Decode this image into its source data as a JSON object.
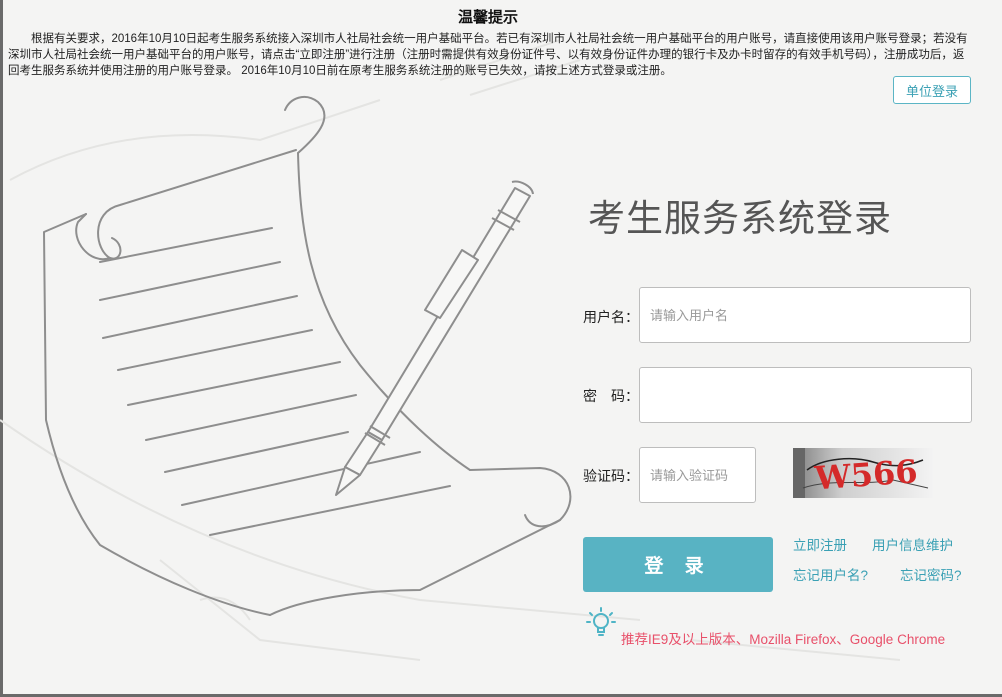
{
  "notice": {
    "title": "温馨提示",
    "body": "根据有关要求，2016年10月10日起考生服务系统接入深圳市人社局社会统一用户基础平台。若已有深圳市人社局社会统一用户基础平台的用户账号，请直接使用该用户账号登录；若没有深圳市人社局社会统一用户基础平台的用户账号，请点击“立即注册”进行注册（注册时需提供有效身份证件号、以有效身份证件办理的银行卡及办卡时留存的有效手机号码），注册成功后，返回考生服务系统并使用注册的用户账号登录。 2016年10月10日前在原考生服务系统注册的账号已失效，请按上述方式登录或注册。"
  },
  "unit_login_label": "单位登录",
  "login": {
    "title": "考生服务系统登录",
    "username": {
      "label": "用户名：",
      "placeholder": "请输入用户名",
      "value": ""
    },
    "password": {
      "label": "密　码：",
      "placeholder": "",
      "value": ""
    },
    "captcha": {
      "label": "验证码：",
      "placeholder": "请输入验证码",
      "value": "",
      "image_text": "W566"
    },
    "submit_label": "登 录"
  },
  "links": {
    "register": "立即注册",
    "user_info": "用户信息维护",
    "forgot_username": "忘记用户名?",
    "forgot_password": "忘记密码?"
  },
  "browser_tip": "推荐IE9及以上版本、Mozilla Firefox、Google Chrome",
  "colors": {
    "accent": "#58b3c3",
    "link": "#3aa0b4",
    "tip": "#e8506a",
    "captcha_text": "#d42a2a"
  },
  "icons": {
    "bulb": "lightbulb-icon"
  }
}
